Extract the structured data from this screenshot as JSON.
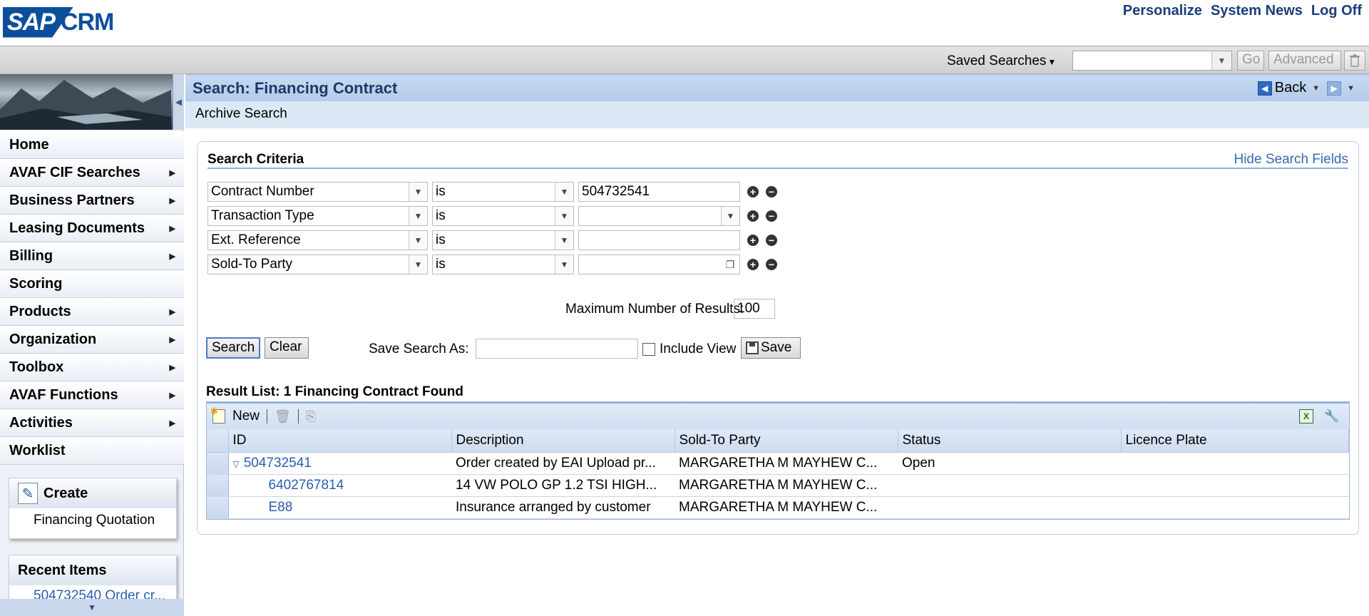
{
  "app": {
    "logo_sap": "SAP",
    "logo_crm": "CRM"
  },
  "top_links": [
    "Personalize",
    "System News",
    "Log Off"
  ],
  "toolbar": {
    "saved_searches": "Saved Searches",
    "go": "Go",
    "advanced": "Advanced"
  },
  "sidebar": {
    "items": [
      {
        "label": "Home",
        "arrow": false
      },
      {
        "label": "AVAF CIF Searches",
        "arrow": true
      },
      {
        "label": "Business Partners",
        "arrow": true
      },
      {
        "label": "Leasing Documents",
        "arrow": true
      },
      {
        "label": "Billing",
        "arrow": true
      },
      {
        "label": "Scoring",
        "arrow": false
      },
      {
        "label": "Products",
        "arrow": true
      },
      {
        "label": "Organization",
        "arrow": true
      },
      {
        "label": "Toolbox",
        "arrow": true
      },
      {
        "label": "AVAF Functions",
        "arrow": true
      },
      {
        "label": "Activities",
        "arrow": true
      },
      {
        "label": "Worklist",
        "arrow": false
      }
    ],
    "create": {
      "title": "Create",
      "link": "Financing Quotation"
    },
    "recent": {
      "title": "Recent Items",
      "item": "504732540 Order cr..."
    }
  },
  "page": {
    "title": "Search: Financing Contract",
    "subtitle": "Archive Search",
    "back": "Back"
  },
  "search": {
    "title": "Search Criteria",
    "hide_link": "Hide Search Fields",
    "rows": [
      {
        "field": "Contract Number",
        "op": "is",
        "value": "504732541"
      },
      {
        "field": "Transaction Type",
        "op": "is",
        "value": ""
      },
      {
        "field": "Ext. Reference",
        "op": "is",
        "value": ""
      },
      {
        "field": "Sold-To Party",
        "op": "is",
        "value": ""
      }
    ],
    "max_label": "Maximum Number of Results:",
    "max_value": "100",
    "search_btn": "Search",
    "clear_btn": "Clear",
    "save_as_label": "Save Search As:",
    "include_view": "Include View",
    "save_btn": "Save"
  },
  "results": {
    "title": "Result List: 1 Financing Contract Found",
    "new_btn": "New",
    "columns": [
      "ID",
      "Description",
      "Sold-To Party",
      "Status",
      "Licence Plate"
    ],
    "rows": [
      {
        "id": "504732541",
        "description": "Order created by EAI Upload pr...",
        "sold_to": "MARGARETHA M MAYHEW C...",
        "status": "Open",
        "plate": ""
      },
      {
        "id": "6402767814",
        "description": "14 VW POLO GP 1.2 TSI HIGH...",
        "sold_to": "MARGARETHA M MAYHEW C...",
        "status": "",
        "plate": ""
      },
      {
        "id": "E88",
        "description": "Insurance arranged by customer",
        "sold_to": "MARGARETHA M MAYHEW C...",
        "status": "",
        "plate": ""
      }
    ]
  }
}
